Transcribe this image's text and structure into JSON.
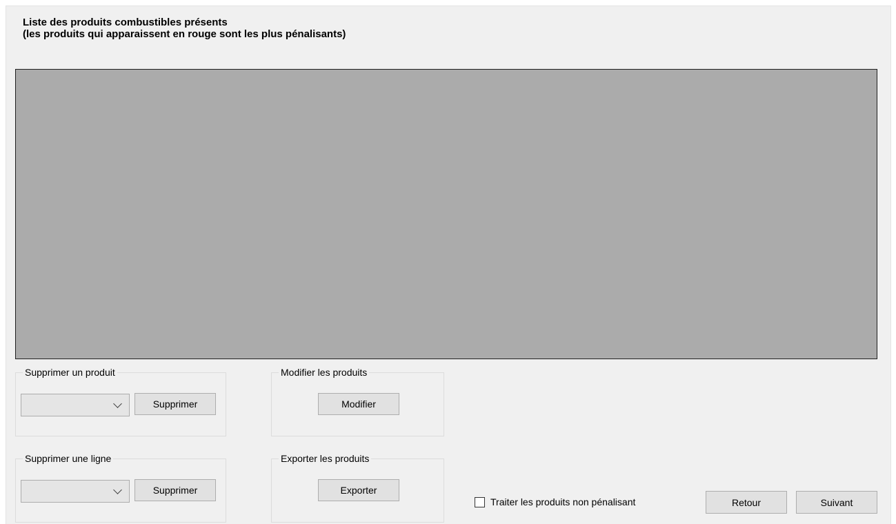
{
  "header": {
    "line1": "Liste des produits combustibles présents",
    "line2": "(les produits qui apparaissent en rouge sont les plus pénalisants)"
  },
  "grid": {
    "background_color": "#ababab"
  },
  "delete_product": {
    "title": "Supprimer un produit",
    "combo_value": "",
    "button_label": "Supprimer"
  },
  "delete_line": {
    "title": "Supprimer une ligne",
    "combo_value": "",
    "button_label": "Supprimer"
  },
  "modify_products": {
    "title": "Modifier les produits",
    "button_label": "Modifier"
  },
  "export_products": {
    "title": "Exporter les produits",
    "button_label": "Exporter"
  },
  "footer": {
    "checkbox_label": "Traiter les produits non pénalisant",
    "checkbox_checked": false,
    "back_label": "Retour",
    "next_label": "Suivant"
  },
  "icons": {
    "combo_arrow": "chevron-down-icon"
  }
}
